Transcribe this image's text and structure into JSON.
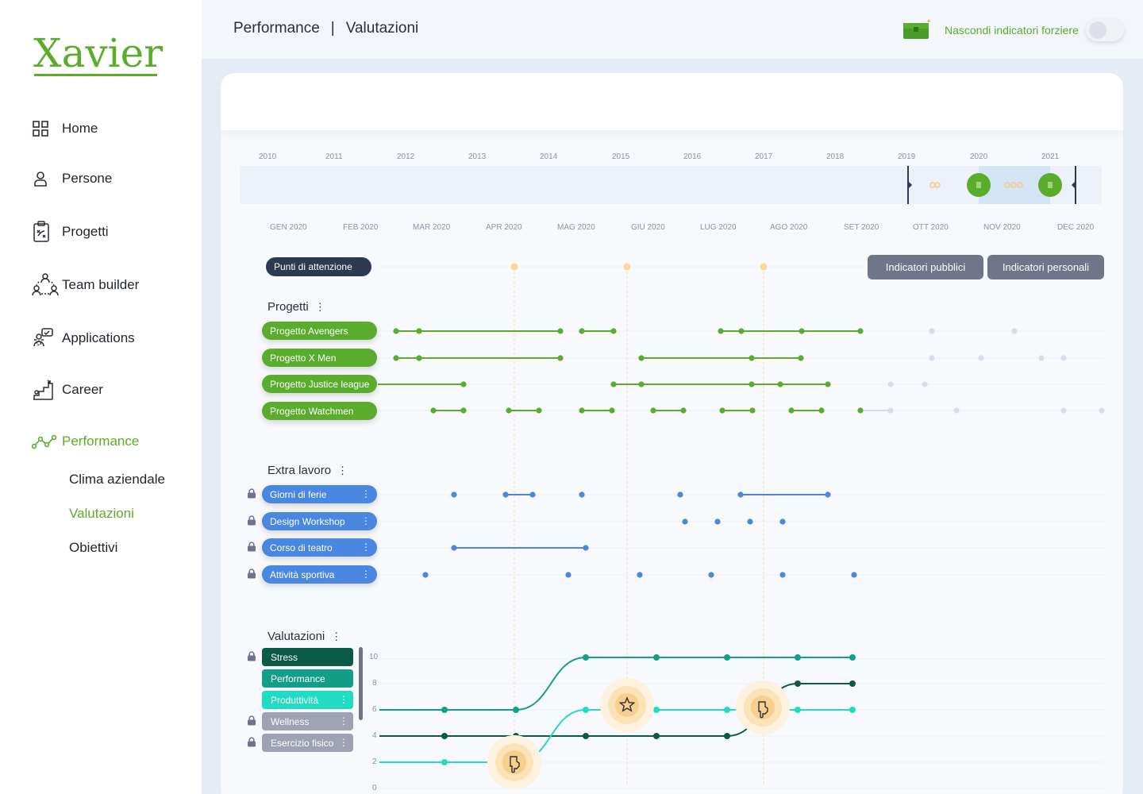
{
  "app": {
    "logo": "Xavier"
  },
  "sidebar": {
    "items": [
      {
        "label": "Home",
        "icon": "grid-icon"
      },
      {
        "label": "Persone",
        "icon": "person-icon"
      },
      {
        "label": "Progetti",
        "icon": "clipboard-icon"
      },
      {
        "label": "Team builder",
        "icon": "team-icon"
      },
      {
        "label": "Applications",
        "icon": "applications-icon"
      },
      {
        "label": "Career",
        "icon": "stairs-icon"
      },
      {
        "label": "Performance",
        "icon": "performance-icon",
        "active": true
      }
    ],
    "subitems": [
      {
        "label": "Clima aziendale"
      },
      {
        "label": "Valutazioni",
        "active": true
      },
      {
        "label": "Obiettivi"
      }
    ],
    "accent": "#5aad2c"
  },
  "header": {
    "breadcrumb": [
      "Performance",
      "Valutazioni"
    ],
    "separator": "|",
    "toggle_label": "Nascondi indicatori forziere",
    "toggle_on": false
  },
  "timeline": {
    "years": [
      "2010",
      "2011",
      "2012",
      "2013",
      "2014",
      "2015",
      "2016",
      "2017",
      "2018",
      "2019",
      "2020",
      "2021"
    ],
    "months": [
      "GEN 2020",
      "FEB 2020",
      "MAR 2020",
      "APR 2020",
      "MAG 2020",
      "GIU 2020",
      "LUG 2020",
      "AGO 2020",
      "SET 2020",
      "OTT 2020",
      "NOV 2020",
      "DEC 2020"
    ]
  },
  "attention": {
    "label": "Punti di attenzione",
    "buttons": [
      "Indicatori pubblici",
      "Indicatori personali"
    ]
  },
  "sections": {
    "progetti": "Progetti",
    "extra": "Extra lavoro",
    "valutazioni": "Valutazioni",
    "kebab": "⋮"
  },
  "progetti": [
    {
      "label": "Progetto Avengers"
    },
    {
      "label": "Progetto X Men"
    },
    {
      "label": "Progetto Justice league"
    },
    {
      "label": "Progetto Watchmen"
    }
  ],
  "extra": [
    {
      "label": "Giorni di ferie"
    },
    {
      "label": "Design Workshop"
    },
    {
      "label": "Corso di teatro"
    },
    {
      "label": "Attività sportiva"
    }
  ],
  "valutazioni": [
    {
      "label": "Stress",
      "color": "#0b5a45",
      "locked": true
    },
    {
      "label": "Performance",
      "color": "#129e87",
      "locked": false
    },
    {
      "label": "Produttività",
      "color": "#21dbc2",
      "locked": false
    },
    {
      "label": "Wellness",
      "color": "#9ea2b3",
      "locked": true
    },
    {
      "label": "Esercizio fisico",
      "color": "#9ea2b3",
      "locked": true
    }
  ],
  "colors": {
    "green": "#5aad2c",
    "blue": "#4a87e0",
    "stress": "#0b5a45",
    "performance": "#129e87",
    "produttivita": "#21dbc2",
    "attention": "#fbd99a"
  },
  "chart_data": {
    "type": "line",
    "categories": [
      "GEN 2020",
      "FEB 2020",
      "MAR 2020",
      "APR 2020",
      "MAG 2020",
      "GIU 2020",
      "LUG 2020",
      "AGO 2020",
      "SET 2020"
    ],
    "ylim": [
      0,
      10
    ],
    "yticks": [
      "0",
      "2",
      "4",
      "6",
      "8",
      "10"
    ],
    "series": [
      {
        "name": "Stress",
        "values": [
          4,
          null,
          4,
          4,
          4,
          4,
          4,
          8,
          8
        ]
      },
      {
        "name": "Performance",
        "values": [
          6,
          null,
          6,
          6,
          10,
          10,
          10,
          10,
          10
        ]
      },
      {
        "name": "Produttività",
        "values": [
          2,
          null,
          2,
          2,
          6,
          6,
          6,
          6,
          6
        ]
      }
    ]
  }
}
